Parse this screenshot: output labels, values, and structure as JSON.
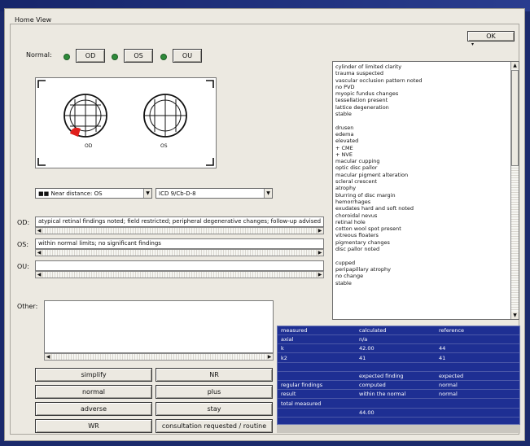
{
  "window": {
    "group_title": "Home View",
    "ok_label": "OK"
  },
  "header_row": {
    "label": "Normal:",
    "buttons": [
      "OD",
      "OS",
      "OU"
    ]
  },
  "eye_diagram": {
    "left_caption": "OD",
    "right_caption": "OS",
    "lesion_color": "#e0201c"
  },
  "dropdowns": {
    "left": "■■ Near distance: OS",
    "right": "ICD 9/Cb-D-8"
  },
  "eye_fields": [
    {
      "label": "OD:",
      "value": "atypical retinal findings noted; field restricted; peripheral degenerative changes; follow-up advised"
    },
    {
      "label": "OS:",
      "value": "within normal limits; no significant findings"
    },
    {
      "label": "OU:",
      "value": ""
    }
  ],
  "other": {
    "label": "Other:",
    "value": ""
  },
  "action_buttons": [
    [
      "simplify",
      "NR"
    ],
    [
      "normal",
      "plus"
    ],
    [
      "adverse",
      "stay"
    ],
    [
      "WR",
      "consultation requested / routine"
    ]
  ],
  "condition_list": [
    "cylinder of limited clarity",
    "trauma suspected",
    "vascular occlusion pattern noted",
    "no PVD",
    "myopic fundus changes",
    "tessellation present",
    "lattice degeneration",
    "stable",
    "",
    "drusen",
    "edema",
    "elevated",
    "+ CME",
    "+ NVE",
    "macular cupping",
    "optic disc pallor",
    "macular pigment alteration",
    "scleral crescent",
    "atrophy",
    "blurring of disc margin",
    "hemorrhages",
    "exudates hard and soft noted",
    "choroidal nevus",
    "retinal hole",
    "cotton wool spot present",
    "vitreous floaters",
    "pigmentary changes",
    "disc pallor noted",
    "",
    "cupped",
    "peripapillary atrophy",
    "no change",
    "stable"
  ],
  "results_table": {
    "rows": [
      [
        "measured",
        "calculated",
        "reference"
      ],
      [
        "axial",
        "n/a",
        ""
      ],
      [
        "k",
        "42.00",
        "44"
      ],
      [
        "k2",
        "41",
        "41"
      ],
      [
        "",
        "",
        ""
      ],
      [
        "",
        "expected finding",
        "expected"
      ],
      [
        "regular findings",
        "computed",
        "normal"
      ],
      [
        "result",
        "within the normal",
        "normal"
      ],
      [
        "total measured",
        "",
        ""
      ],
      [
        "",
        "44.00",
        ""
      ]
    ]
  }
}
